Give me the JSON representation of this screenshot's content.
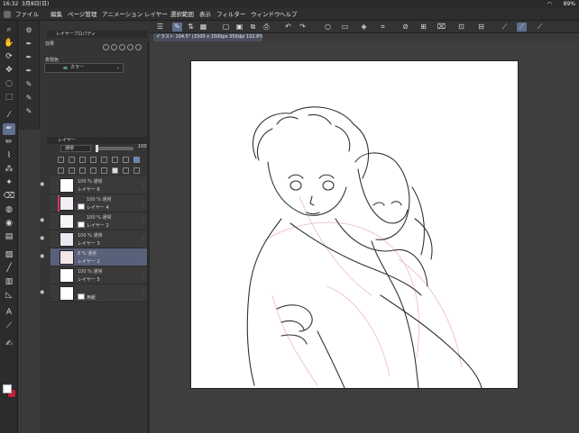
{
  "status": {
    "time": "16:32",
    "date": "3月8日(日)",
    "battery": "89%",
    "wifi": "wifi-icon"
  },
  "menu": [
    "ファイル",
    "編集",
    "ページ管理",
    "アニメーション",
    "レイヤー",
    "選択範囲",
    "表示",
    "フィルター",
    "ウィンドウ",
    "ヘルプ"
  ],
  "document": {
    "tab": "イラスト 104.5° (1500 x 1500px 350dpi 102.8%)"
  },
  "properties": {
    "title": "レイヤープロパティ",
    "effect_label": "効果",
    "expression_label": "表現色",
    "expression_value": "カラー"
  },
  "layers": {
    "title": "レイヤー",
    "blend_mode": "通常",
    "opacity": "100",
    "items": [
      {
        "name": "レイヤー 6",
        "blend": "100 % 通常",
        "selected": false,
        "visible": true,
        "bar": "",
        "mini": false
      },
      {
        "name": "レイヤー 4",
        "blend": "100 % 通常",
        "selected": false,
        "visible": false,
        "bar": "#d04060",
        "mini": true
      },
      {
        "name": "レイヤー 2",
        "blend": "100 % 通常",
        "selected": false,
        "visible": true,
        "bar": "",
        "mini": true
      },
      {
        "name": "レイヤー 3",
        "blend": "100 % 通常",
        "selected": false,
        "visible": true,
        "bar": "",
        "mini": false
      },
      {
        "name": "レイヤー 1",
        "blend": "8 % 通常",
        "selected": true,
        "visible": true,
        "bar": "",
        "mini": false
      },
      {
        "name": "レイヤー 5",
        "blend": "100 % 通常",
        "selected": false,
        "visible": false,
        "bar": "",
        "mini": false
      },
      {
        "name": "用紙",
        "blend": "",
        "selected": false,
        "visible": true,
        "bar": "",
        "mini": true
      }
    ]
  },
  "colors": {
    "foreground": "#ffffff",
    "background": "#c0203a",
    "accent": "#59607a"
  }
}
